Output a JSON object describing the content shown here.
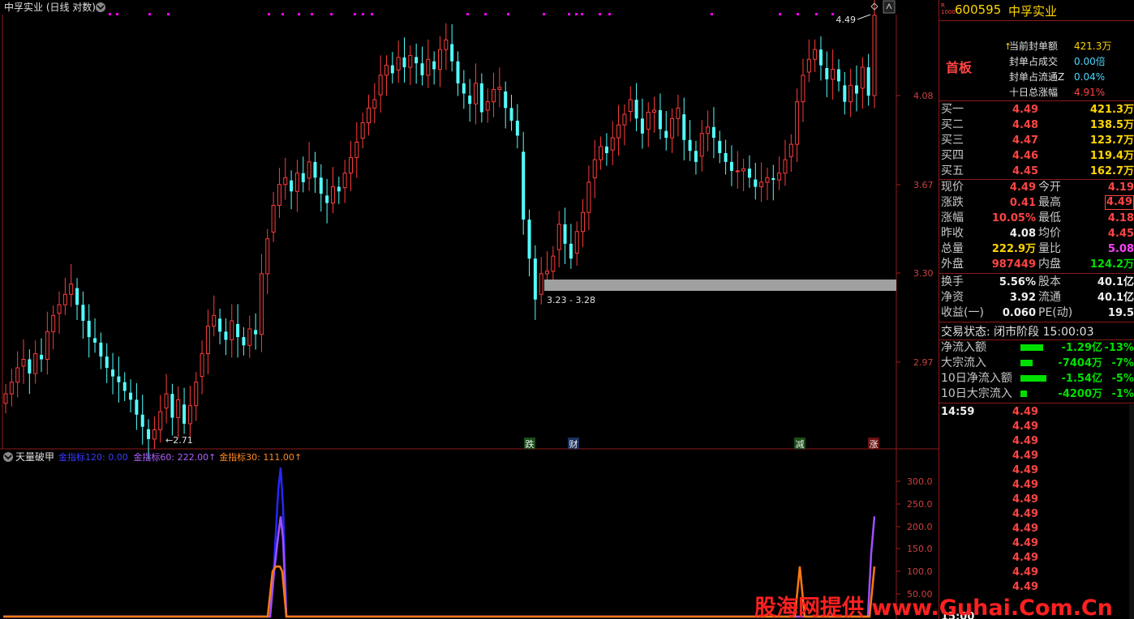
{
  "main_title": "中孚实业 (日线 对数)",
  "price_axis": [
    "4.08",
    "3.67",
    "3.30",
    "2.97"
  ],
  "chart_annotations": {
    "high_label": "4.49",
    "low_label": "2.71",
    "gap_label": "3.23 - 3.28"
  },
  "event_markers": [
    "跌",
    "财",
    "减",
    "涨"
  ],
  "indicator": {
    "name": "天量破甲",
    "lines": [
      {
        "label": "金指标120: 0.00",
        "color": "#3a3aff"
      },
      {
        "label": "金指标60: 222.00↑",
        "color": "#b060ff"
      },
      {
        "label": "金指标30: 111.00↑",
        "color": "#ff8a20"
      }
    ],
    "axis": [
      "300.0",
      "250.0",
      "200.0",
      "150.0",
      "100.0",
      "50.00"
    ],
    "series": [
      {
        "name": "金指标120",
        "color": "#2626ff",
        "points": [
          [
            333,
            0
          ],
          [
            338,
            120
          ],
          [
            343,
            280
          ],
          [
            346,
            330
          ],
          [
            349,
            240
          ],
          [
            353,
            0
          ]
        ]
      },
      {
        "name": "金指标60",
        "color": "#a050ff",
        "points": [
          [
            333,
            0
          ],
          [
            338,
            100
          ],
          [
            343,
            180
          ],
          [
            346,
            222
          ],
          [
            349,
            170
          ],
          [
            353,
            0
          ],
          [
            1070,
            0
          ],
          [
            1074,
            140
          ],
          [
            1078,
            222
          ]
        ]
      },
      {
        "name": "金指标30",
        "color": "#ff7a10",
        "points": [
          [
            330,
            0
          ],
          [
            336,
            100
          ],
          [
            340,
            111
          ],
          [
            345,
            111
          ],
          [
            348,
            100
          ],
          [
            353,
            0
          ],
          [
            980,
            0
          ],
          [
            986,
            111
          ],
          [
            992,
            0
          ],
          [
            1072,
            0
          ],
          [
            1078,
            111
          ]
        ]
      }
    ]
  },
  "candles": "see script",
  "quote": {
    "code": "600595",
    "name": "中孚实业",
    "small_tag": "R 1000",
    "status_badge": "首板",
    "seal_info": [
      {
        "label": "当前封单额",
        "value": "421.3万",
        "color": "yellow",
        "arrow": "↑"
      },
      {
        "label": "封单占成交",
        "value": "0.00倍",
        "color": "cyan"
      },
      {
        "label": "封单占流通Z",
        "value": "0.04%",
        "color": "cyan"
      },
      {
        "label": "十日总涨幅",
        "value": "4.91%",
        "color": "red"
      }
    ],
    "bids": [
      {
        "label": "买一",
        "price": "4.49",
        "vol": "421.3万"
      },
      {
        "label": "买二",
        "price": "4.48",
        "vol": "138.5万"
      },
      {
        "label": "买三",
        "price": "4.47",
        "vol": "123.7万"
      },
      {
        "label": "买四",
        "price": "4.46",
        "vol": "119.4万"
      },
      {
        "label": "买五",
        "price": "4.45",
        "vol": "162.7万"
      }
    ],
    "stats": [
      {
        "l1": "现价",
        "v1": "4.49",
        "c1": "red",
        "l2": "今开",
        "v2": "4.19",
        "c2": "red"
      },
      {
        "l1": "涨跌",
        "v1": "0.41",
        "c1": "red",
        "l2": "最高",
        "v2": "4.49",
        "c2": "red",
        "box2": true
      },
      {
        "l1": "涨幅",
        "v1": "10.05%",
        "c1": "red",
        "l2": "最低",
        "v2": "4.18",
        "c2": "red"
      },
      {
        "l1": "昨收",
        "v1": "4.08",
        "c1": "white",
        "l2": "均价",
        "v2": "4.45",
        "c2": "red"
      },
      {
        "l1": "总量",
        "v1": "222.9万",
        "c1": "yellow",
        "l2": "量比",
        "v2": "5.08",
        "c2": "magenta"
      },
      {
        "l1": "外盘",
        "v1": "987449",
        "c1": "red",
        "l2": "内盘",
        "v2": "124.2万",
        "c2": "green"
      }
    ],
    "stats2": [
      {
        "l1": "换手",
        "v1": "5.56%",
        "c1": "white",
        "l2": "股本",
        "v2": "40.1亿",
        "c2": "white"
      },
      {
        "l1": "净资",
        "v1": "3.92",
        "c1": "white",
        "l2": "流通",
        "v2": "40.1亿",
        "c2": "white"
      },
      {
        "l1": "收益(一)",
        "v1": "0.060",
        "c1": "white",
        "l2": "PE(动)",
        "v2": "19.5",
        "c2": "white"
      }
    ],
    "trade_status": "交易状态: 闭市阶段 15:00:03",
    "flows": [
      {
        "label": "净流入额",
        "value": "-1.29亿",
        "pct": "-13%",
        "bar": 28
      },
      {
        "label": "大宗流入",
        "value": "-7404万",
        "pct": "-7%",
        "bar": 15
      },
      {
        "label": "10日净流入额",
        "value": "-1.54亿",
        "pct": "-5%",
        "bar": 32
      },
      {
        "label": "10日大宗流入",
        "value": "-4200万",
        "pct": "-1%",
        "bar": 8
      }
    ],
    "ticks_first_time": "14:59",
    "ticks_last_time": "15:00",
    "tick_price": "4.49",
    "tick_count": 13
  },
  "watermark": "股海网提供 www.Guhai.Com.Cn"
}
